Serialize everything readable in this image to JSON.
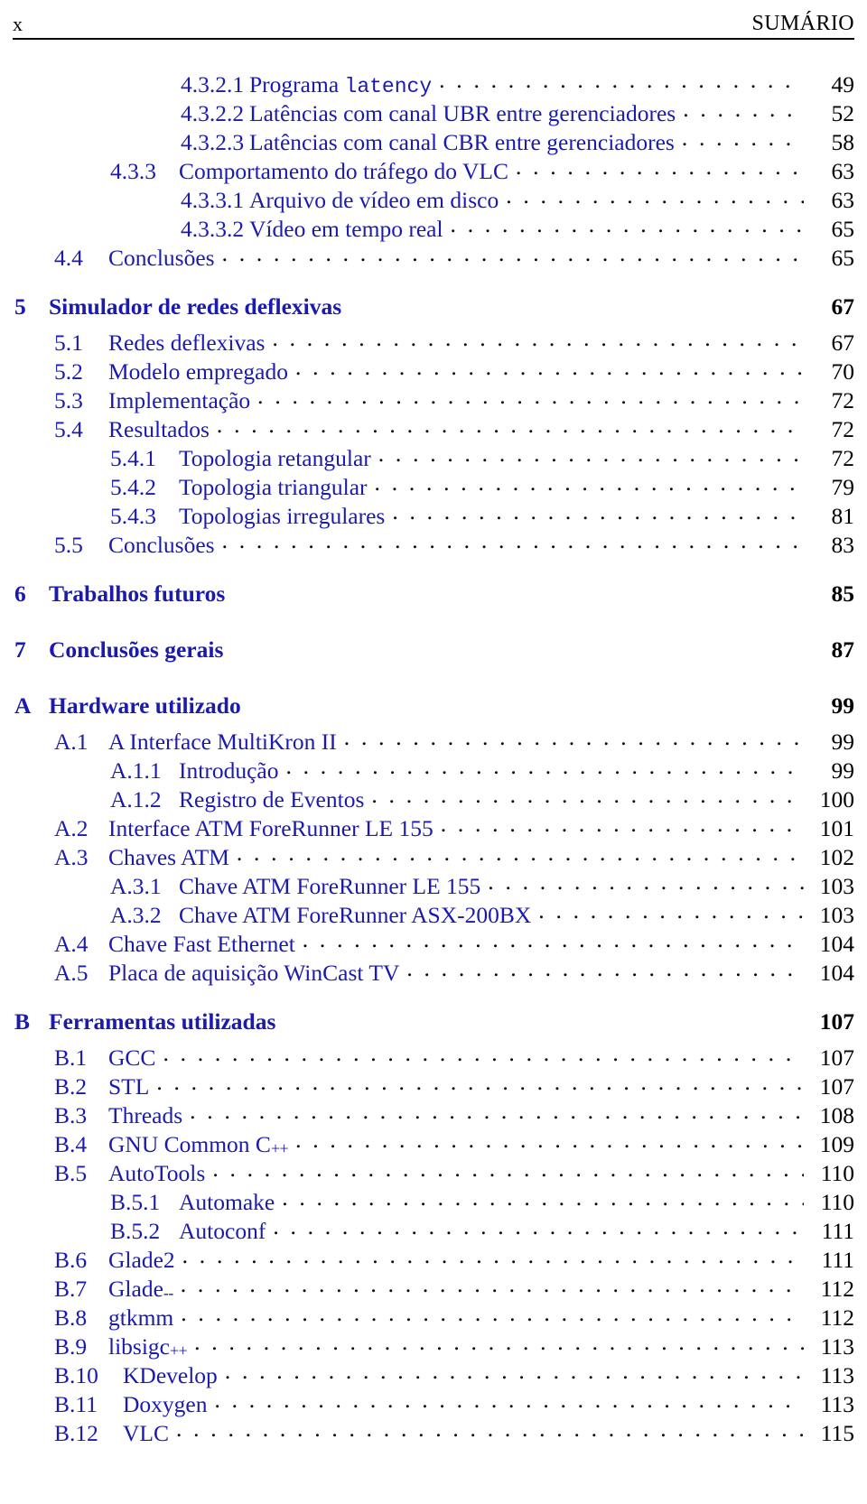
{
  "header": {
    "folio": "x",
    "title": "SUMÁRIO"
  },
  "colors": {
    "text_blue": "#1a1ab0",
    "page_number_black": "#000000",
    "rule_black": "#000000"
  },
  "toc": {
    "entries": [
      {
        "level": "subsubsection",
        "num": "4.3.2.1",
        "title": "Programa ",
        "mono": "latency",
        "page": "49"
      },
      {
        "level": "subsubsection",
        "num": "4.3.2.2",
        "title": "Latências com canal UBR entre gerenciadores",
        "page": "52"
      },
      {
        "level": "subsubsection",
        "num": "4.3.2.3",
        "title": "Latências com canal CBR entre gerenciadores",
        "page": "58"
      },
      {
        "level": "subsection",
        "num": "4.3.3",
        "title": "Comportamento do tráfego do VLC",
        "page": "63"
      },
      {
        "level": "subsubsection",
        "num": "4.3.3.1",
        "title": "Arquivo de vídeo em disco",
        "page": "63"
      },
      {
        "level": "subsubsection",
        "num": "4.3.3.2",
        "title": "Vídeo em tempo real",
        "page": "65"
      },
      {
        "level": "section",
        "num": "4.4",
        "title": "Conclusões",
        "page": "65"
      },
      {
        "level": "chapter",
        "num": "5",
        "title": "Simulador de redes deflexivas",
        "page": "67"
      },
      {
        "level": "section",
        "num": "5.1",
        "title": "Redes deflexivas",
        "page": "67"
      },
      {
        "level": "section",
        "num": "5.2",
        "title": "Modelo empregado",
        "page": "70"
      },
      {
        "level": "section",
        "num": "5.3",
        "title": "Implementação",
        "page": "72"
      },
      {
        "level": "section",
        "num": "5.4",
        "title": "Resultados",
        "page": "72"
      },
      {
        "level": "subsection",
        "num": "5.4.1",
        "title": "Topologia retangular",
        "page": "72"
      },
      {
        "level": "subsection",
        "num": "5.4.2",
        "title": "Topologia triangular",
        "page": "79"
      },
      {
        "level": "subsection",
        "num": "5.4.3",
        "title": "Topologias irregulares",
        "page": "81"
      },
      {
        "level": "section",
        "num": "5.5",
        "title": "Conclusões",
        "page": "83"
      },
      {
        "level": "chapter",
        "num": "6",
        "title": "Trabalhos futuros",
        "page": "85"
      },
      {
        "level": "chapter",
        "num": "7",
        "title": "Conclusões gerais",
        "page": "87"
      },
      {
        "level": "chapter",
        "num": "A",
        "title": "Hardware utilizado",
        "page": "99"
      },
      {
        "level": "section",
        "num": "A.1",
        "title": "A Interface MultiKron II",
        "page": "99"
      },
      {
        "level": "subsection",
        "num": "A.1.1",
        "title": "Introdução",
        "page": "99"
      },
      {
        "level": "subsection",
        "num": "A.1.2",
        "title": "Registro de Eventos",
        "page": "100"
      },
      {
        "level": "section",
        "num": "A.2",
        "title": "Interface ATM ForeRunner LE 155",
        "page": "101"
      },
      {
        "level": "section",
        "num": "A.3",
        "title": "Chaves ATM",
        "page": "102"
      },
      {
        "level": "subsection",
        "num": "A.3.1",
        "title": "Chave ATM ForeRunner LE 155",
        "page": "103"
      },
      {
        "level": "subsection",
        "num": "A.3.2",
        "title": "Chave ATM ForeRunner ASX-200BX",
        "page": "103"
      },
      {
        "level": "section",
        "num": "A.4",
        "title": "Chave Fast Ethernet",
        "page": "104"
      },
      {
        "level": "section",
        "num": "A.5",
        "title": "Placa de aquisição WinCast TV",
        "page": "104"
      },
      {
        "level": "chapter",
        "num": "B",
        "title": "Ferramentas utilizadas",
        "page": "107"
      },
      {
        "level": "section",
        "num": "B.1",
        "title": "GCC",
        "page": "107"
      },
      {
        "level": "section",
        "num": "B.2",
        "title": "STL",
        "page": "107"
      },
      {
        "level": "section",
        "num": "B.3",
        "title": "Threads",
        "page": "108"
      },
      {
        "level": "section",
        "num": "B.4",
        "title": "GNU Common C",
        "suffix": "++",
        "page": "109"
      },
      {
        "level": "section",
        "num": "B.5",
        "title": "AutoTools",
        "page": "110"
      },
      {
        "level": "subsection",
        "num": "B.5.1",
        "title": "Automake",
        "page": "110"
      },
      {
        "level": "subsection",
        "num": "B.5.2",
        "title": "Autoconf",
        "page": "111"
      },
      {
        "level": "section",
        "num": "B.6",
        "title": "Glade2",
        "page": "111"
      },
      {
        "level": "section",
        "num": "B.7",
        "title": "Glade",
        "suffix": "--",
        "page": "112"
      },
      {
        "level": "section",
        "num": "B.8",
        "title": "gtkmm",
        "page": "112"
      },
      {
        "level": "section",
        "num": "B.9",
        "title": "libsigc",
        "suffix": "++",
        "page": "113"
      },
      {
        "level": "section",
        "num": "B.10",
        "title": "KDevelop",
        "page": "113",
        "wide": true
      },
      {
        "level": "section",
        "num": "B.11",
        "title": "Doxygen",
        "page": "113",
        "wide": true
      },
      {
        "level": "section",
        "num": "B.12",
        "title": "VLC",
        "page": "115",
        "wide": true
      }
    ]
  }
}
